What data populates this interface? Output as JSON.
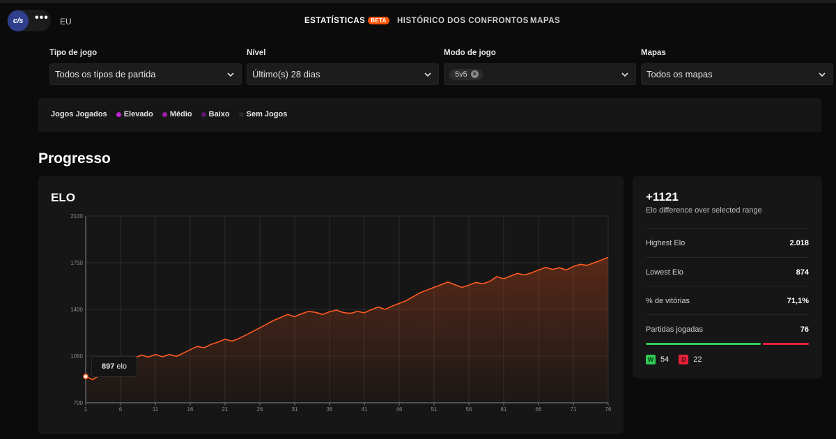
{
  "header": {
    "logo_text": "c/s",
    "region": "EU",
    "nav": [
      {
        "label": "ESTATÍSTICAS",
        "badge": "BETA",
        "active": true
      },
      {
        "label": "HISTÓRICO DOS CONFRONTOS"
      },
      {
        "label": "MAPAS"
      }
    ]
  },
  "filters": {
    "game_type": {
      "label": "Tipo de jogo",
      "value": "Todos os tipos de partida"
    },
    "level": {
      "label": "Nível",
      "value": "Último(s) 28 dias"
    },
    "game_mode": {
      "label": "Modo de jogo",
      "chip": "5v5"
    },
    "maps": {
      "label": "Mapas",
      "value": "Todos os mapas"
    }
  },
  "legend": {
    "title": "Jogos Jogados",
    "items": [
      {
        "label": "Elevado",
        "color": "#c026d3"
      },
      {
        "label": "Médio",
        "color": "#9d1fa8"
      },
      {
        "label": "Baixo",
        "color": "#5e1670"
      },
      {
        "label": "Sem Jogos",
        "color": "#2a2a2a"
      }
    ]
  },
  "section_title": "Progresso",
  "chart": {
    "title": "ELO",
    "tooltip_value": "897",
    "tooltip_unit": "elo"
  },
  "chart_data": {
    "type": "area",
    "title": "ELO",
    "xlabel": "",
    "ylabel": "",
    "x_ticks": [
      1,
      6,
      11,
      16,
      21,
      26,
      31,
      36,
      41,
      46,
      51,
      56,
      61,
      66,
      71,
      76
    ],
    "y_ticks": [
      700,
      1050,
      1400,
      1750,
      2100
    ],
    "xlim": [
      1,
      76
    ],
    "ylim": [
      700,
      2100
    ],
    "grid": true,
    "color": "#ff5a1f",
    "x": [
      1,
      2,
      3,
      4,
      5,
      6,
      7,
      8,
      9,
      10,
      11,
      12,
      13,
      14,
      15,
      16,
      17,
      18,
      19,
      20,
      21,
      22,
      23,
      24,
      25,
      26,
      27,
      28,
      29,
      30,
      31,
      32,
      33,
      34,
      35,
      36,
      37,
      38,
      39,
      40,
      41,
      42,
      43,
      44,
      45,
      46,
      47,
      48,
      49,
      50,
      51,
      52,
      53,
      54,
      55,
      56,
      57,
      58,
      59,
      60,
      61,
      62,
      63,
      64,
      65,
      66,
      67,
      68,
      69,
      70,
      71,
      72,
      73,
      74,
      75,
      76
    ],
    "values": [
      897,
      874,
      905,
      935,
      968,
      995,
      1015,
      1035,
      1058,
      1042,
      1062,
      1045,
      1062,
      1048,
      1072,
      1098,
      1122,
      1112,
      1138,
      1155,
      1176,
      1162,
      1182,
      1208,
      1235,
      1262,
      1290,
      1318,
      1340,
      1362,
      1345,
      1368,
      1385,
      1378,
      1362,
      1382,
      1395,
      1376,
      1370,
      1385,
      1375,
      1398,
      1418,
      1400,
      1425,
      1445,
      1465,
      1495,
      1525,
      1545,
      1565,
      1585,
      1605,
      1585,
      1565,
      1582,
      1602,
      1592,
      1610,
      1645,
      1630,
      1650,
      1670,
      1658,
      1675,
      1695,
      1715,
      1700,
      1712,
      1696,
      1722,
      1738,
      1730,
      1750,
      1770,
      1790
    ],
    "highlight": {
      "x": 1,
      "y": 897
    }
  },
  "stats": {
    "diff": "+1121",
    "diff_label": "Elo difference over selected range",
    "rows": [
      {
        "label": "Highest Elo",
        "value": "2.018"
      },
      {
        "label": "Lowest Elo",
        "value": "874"
      },
      {
        "label": "% de vitórias",
        "value": "71,1%"
      },
      {
        "label": "Partidas jogadas",
        "value": "76"
      }
    ],
    "wins": 54,
    "losses": 22,
    "win_letter": "W",
    "loss_letter": "D",
    "win_color": "#2ecc55",
    "loss_color": "#e5213a"
  }
}
